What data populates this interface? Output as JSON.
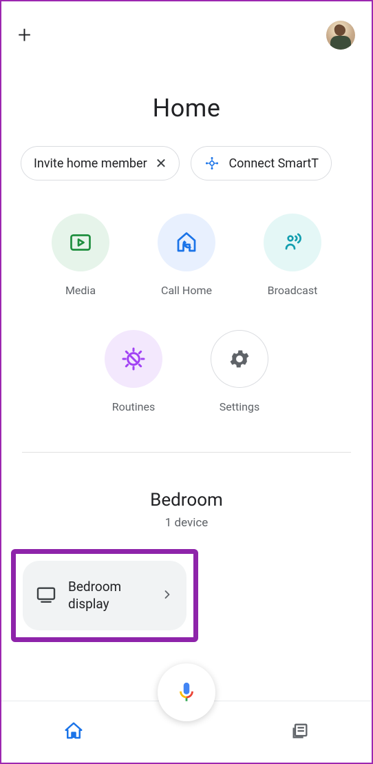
{
  "header": {
    "title": "Home"
  },
  "chips": {
    "invite": {
      "label": "Invite home member"
    },
    "connect": {
      "label": "Connect SmartT"
    }
  },
  "actions": {
    "media": "Media",
    "call": "Call Home",
    "broadcast": "Broadcast",
    "routines": "Routines",
    "settings": "Settings"
  },
  "room": {
    "name": "Bedroom",
    "device_count": "1 device",
    "device": {
      "name": "Bedroom display"
    }
  }
}
